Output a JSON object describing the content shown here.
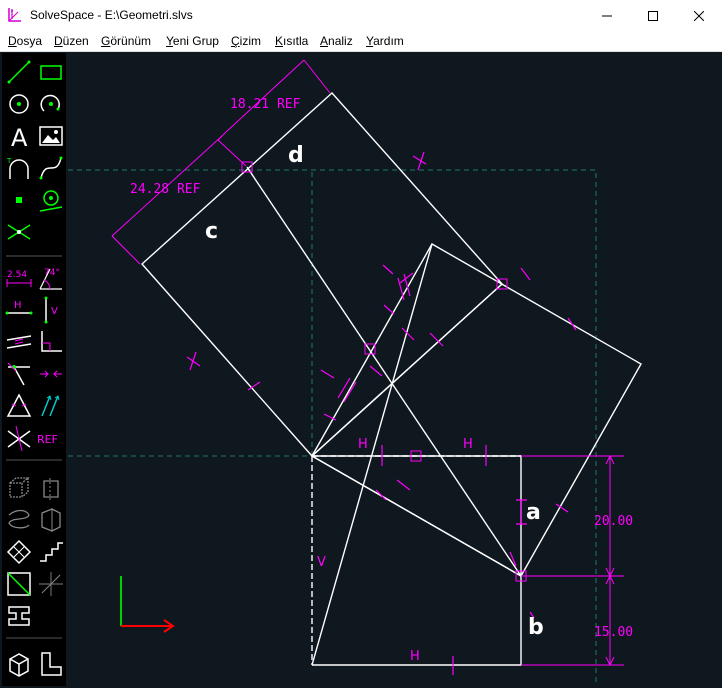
{
  "window": {
    "title": "SolveSpace - E:\\Geometri.slvs",
    "controls": [
      "minimize",
      "maximize",
      "close"
    ]
  },
  "menu": [
    {
      "label": "Dosya",
      "ul": "D",
      "rest": "osya"
    },
    {
      "label": "Düzen",
      "ul": "D",
      "rest": "üzen"
    },
    {
      "label": "Görünüm",
      "ul": "G",
      "rest": "örünüm"
    },
    {
      "label": "Yeni Grup",
      "ul": "Y",
      "rest": "eni Grup"
    },
    {
      "label": "Çizim",
      "ul": "Ç",
      "rest": "izim"
    },
    {
      "label": "Kısıtla",
      "ul": "K",
      "rest": "ısıtla"
    },
    {
      "label": "Analiz",
      "ul": "A",
      "rest": "naliz"
    },
    {
      "label": "Yardım",
      "ul": "Y",
      "rest": "ardım"
    }
  ],
  "toolbar": {
    "dimension_label": "2.54",
    "angle_label": "74°",
    "ref_label": "REF",
    "h_label": "H",
    "v_label": "V"
  },
  "sketch": {
    "dimensions": {
      "top_ref": "18.21 REF",
      "left_ref": "24.28 REF",
      "right_upper": "20.00",
      "right_lower": "15.00"
    },
    "point_labels": {
      "a": "a",
      "b": "b",
      "c": "c",
      "d": "d"
    },
    "constraint_labels": {
      "h": "H",
      "v": "V"
    }
  },
  "colors": {
    "background": "#0f171f",
    "geometry": "#ffffff",
    "constraint": "#ff00ff",
    "construction": "#1f7a66",
    "axis_x": "#ff0000",
    "axis_y": "#00d000"
  }
}
